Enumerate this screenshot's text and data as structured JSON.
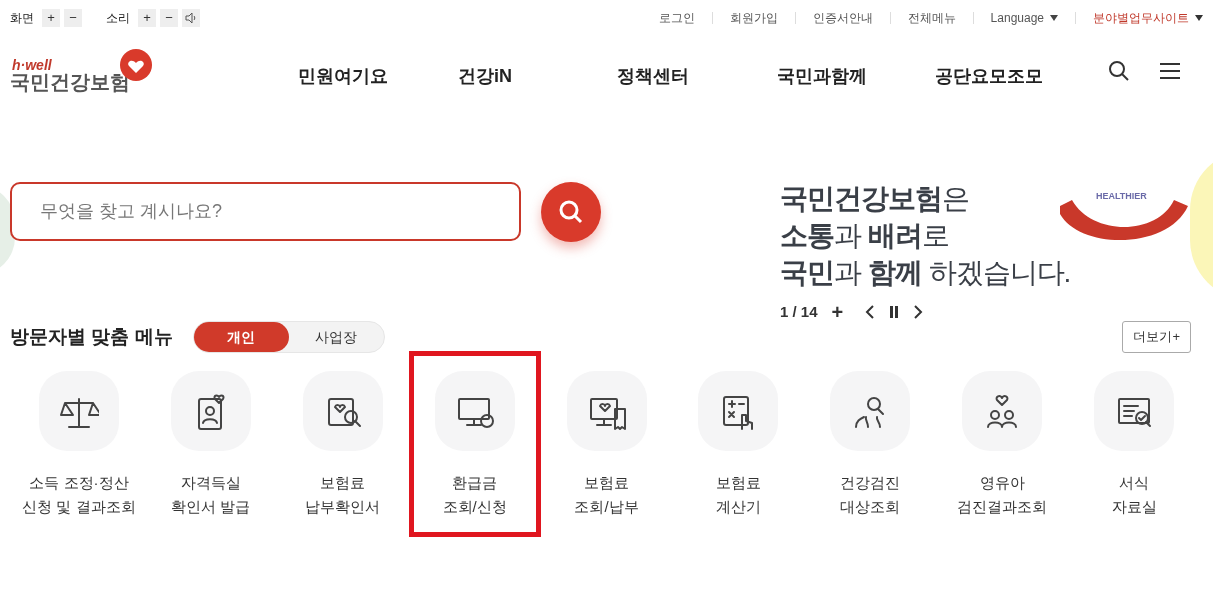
{
  "accessibility": {
    "screen_label": "화면",
    "sound_label": "소리",
    "plus": "+",
    "minus": "−"
  },
  "top_links": [
    {
      "label": "로그인",
      "kind": "link"
    },
    {
      "label": "회원가입",
      "kind": "link"
    },
    {
      "label": "인증서안내",
      "kind": "link"
    },
    {
      "label": "전체메뉴",
      "kind": "link"
    },
    {
      "label": "Language",
      "kind": "dropdown"
    },
    {
      "label": "분야별업무사이트",
      "kind": "dropdown_accent"
    }
  ],
  "logo": {
    "tagline": "h·well",
    "name": "국민건강보험"
  },
  "nav": [
    "민원여기요",
    "건강iN",
    "정책센터",
    "국민과함께",
    "공단요모조모"
  ],
  "search": {
    "placeholder": "무엇을 찾고 계시나요?"
  },
  "banner": {
    "lines": [
      "**국민건강보험**은",
      "**소통**과 **배려**로",
      "**국민**과 **함께** 하겠습니다."
    ],
    "badge": "HEALTHIER",
    "counter": "1 / 14",
    "plus": "+"
  },
  "menu": {
    "title": "방문자별 맞춤 메뉴",
    "tabs": [
      {
        "label": "개인",
        "selected": true
      },
      {
        "label": "사업장",
        "selected": false
      }
    ],
    "more": "더보기+",
    "items": [
      {
        "lines": [
          "소득 조정·정산",
          "신청 및 결과조회"
        ],
        "highlighted": false
      },
      {
        "lines": [
          "자격득실",
          "확인서 발급"
        ],
        "highlighted": false
      },
      {
        "lines": [
          "보험료",
          "납부확인서"
        ],
        "highlighted": false
      },
      {
        "lines": [
          "환급금",
          "조회/신청"
        ],
        "highlighted": true
      },
      {
        "lines": [
          "보험료",
          "조회/납부"
        ],
        "highlighted": false
      },
      {
        "lines": [
          "보험료",
          "계산기"
        ],
        "highlighted": false
      },
      {
        "lines": [
          "건강검진",
          "대상조회"
        ],
        "highlighted": false
      },
      {
        "lines": [
          "영유아",
          "검진결과조회"
        ],
        "highlighted": false
      },
      {
        "lines": [
          "서식",
          "자료실"
        ],
        "highlighted": false
      }
    ]
  }
}
